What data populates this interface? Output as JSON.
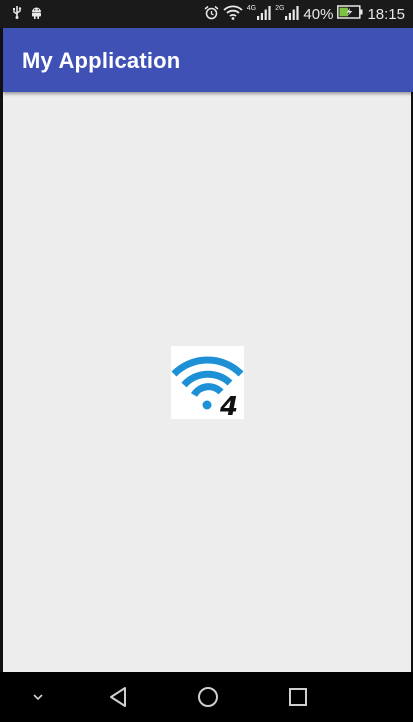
{
  "status_bar": {
    "left_icons": [
      "usb-icon",
      "android-debug-icon"
    ],
    "right_icons": [
      "alarm-icon",
      "wifi-signal-icon",
      "cellular-signal-icon",
      "cellular-signal-icon",
      "battery-charging-icon"
    ],
    "network_label_1": "4G",
    "network_label_2": "2G",
    "battery_percent": "40%",
    "time": "18:15"
  },
  "app_bar": {
    "title": "My Application",
    "color": "#3f51b5"
  },
  "content": {
    "background": "#ededed",
    "image": {
      "icon": "wifi-4-icon",
      "overlay_text": "4",
      "wifi_color": "#1e90d6"
    }
  },
  "nav_bar": {
    "buttons": [
      "collapse-icon",
      "back-icon",
      "home-icon",
      "recents-icon"
    ]
  }
}
